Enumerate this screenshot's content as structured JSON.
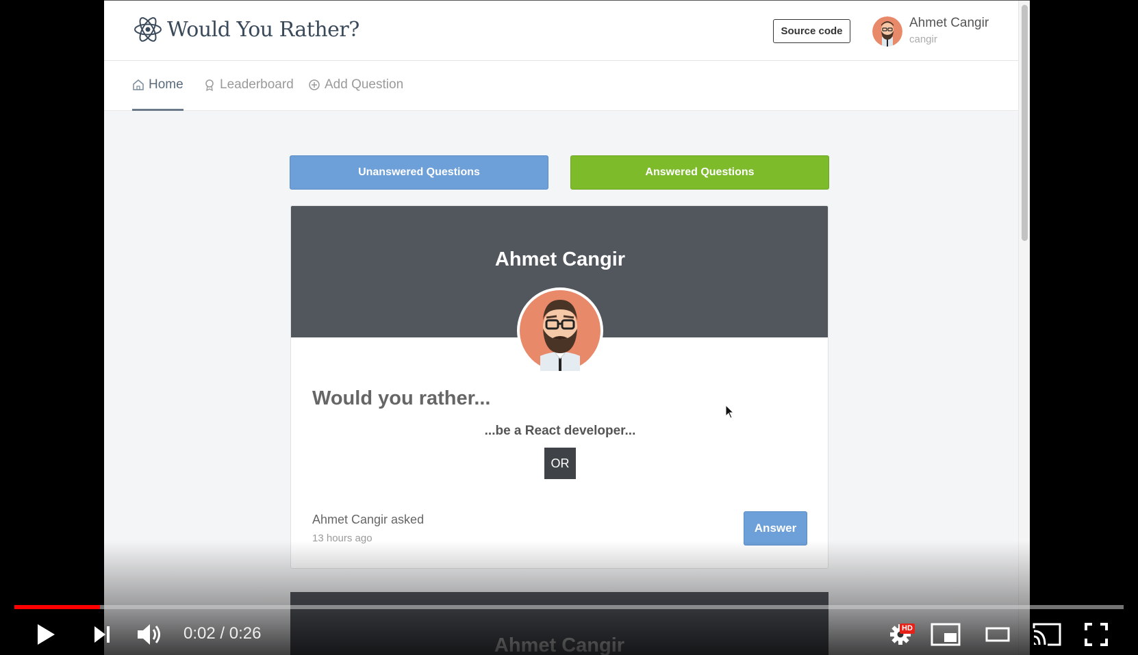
{
  "app": {
    "title": "Would You Rather?",
    "source_button": "Source code",
    "user": {
      "name": "Ahmet Cangir",
      "handle": "cangir"
    }
  },
  "nav": {
    "items": [
      {
        "label": "Home",
        "icon": "home-icon",
        "active": true
      },
      {
        "label": "Leaderboard",
        "icon": "award-icon",
        "active": false
      },
      {
        "label": "Add Question",
        "icon": "plus-circle-icon",
        "active": false
      }
    ]
  },
  "tabs": {
    "unanswered": "Unanswered Questions",
    "answered": "Answered Questions"
  },
  "question": {
    "author": "Ahmet Cangir",
    "title": "Would you rather...",
    "option_one": "...be a React developer...",
    "or_label": "OR",
    "asked_by": "Ahmet Cangir asked",
    "asked_time": "13 hours ago",
    "answer_button": "Answer"
  },
  "next_question": {
    "author": "Ahmet Cangir"
  },
  "player": {
    "current_time": "0:02",
    "duration": "0:26",
    "time_display": "0:02 / 0:26",
    "progress_fraction": 0.077,
    "quality_badge": "HD"
  },
  "colors": {
    "unanswered_tab": "#6d9fd8",
    "answered_tab": "#7dbb2a",
    "card_header": "#52565d",
    "progress": "#ff0000"
  }
}
